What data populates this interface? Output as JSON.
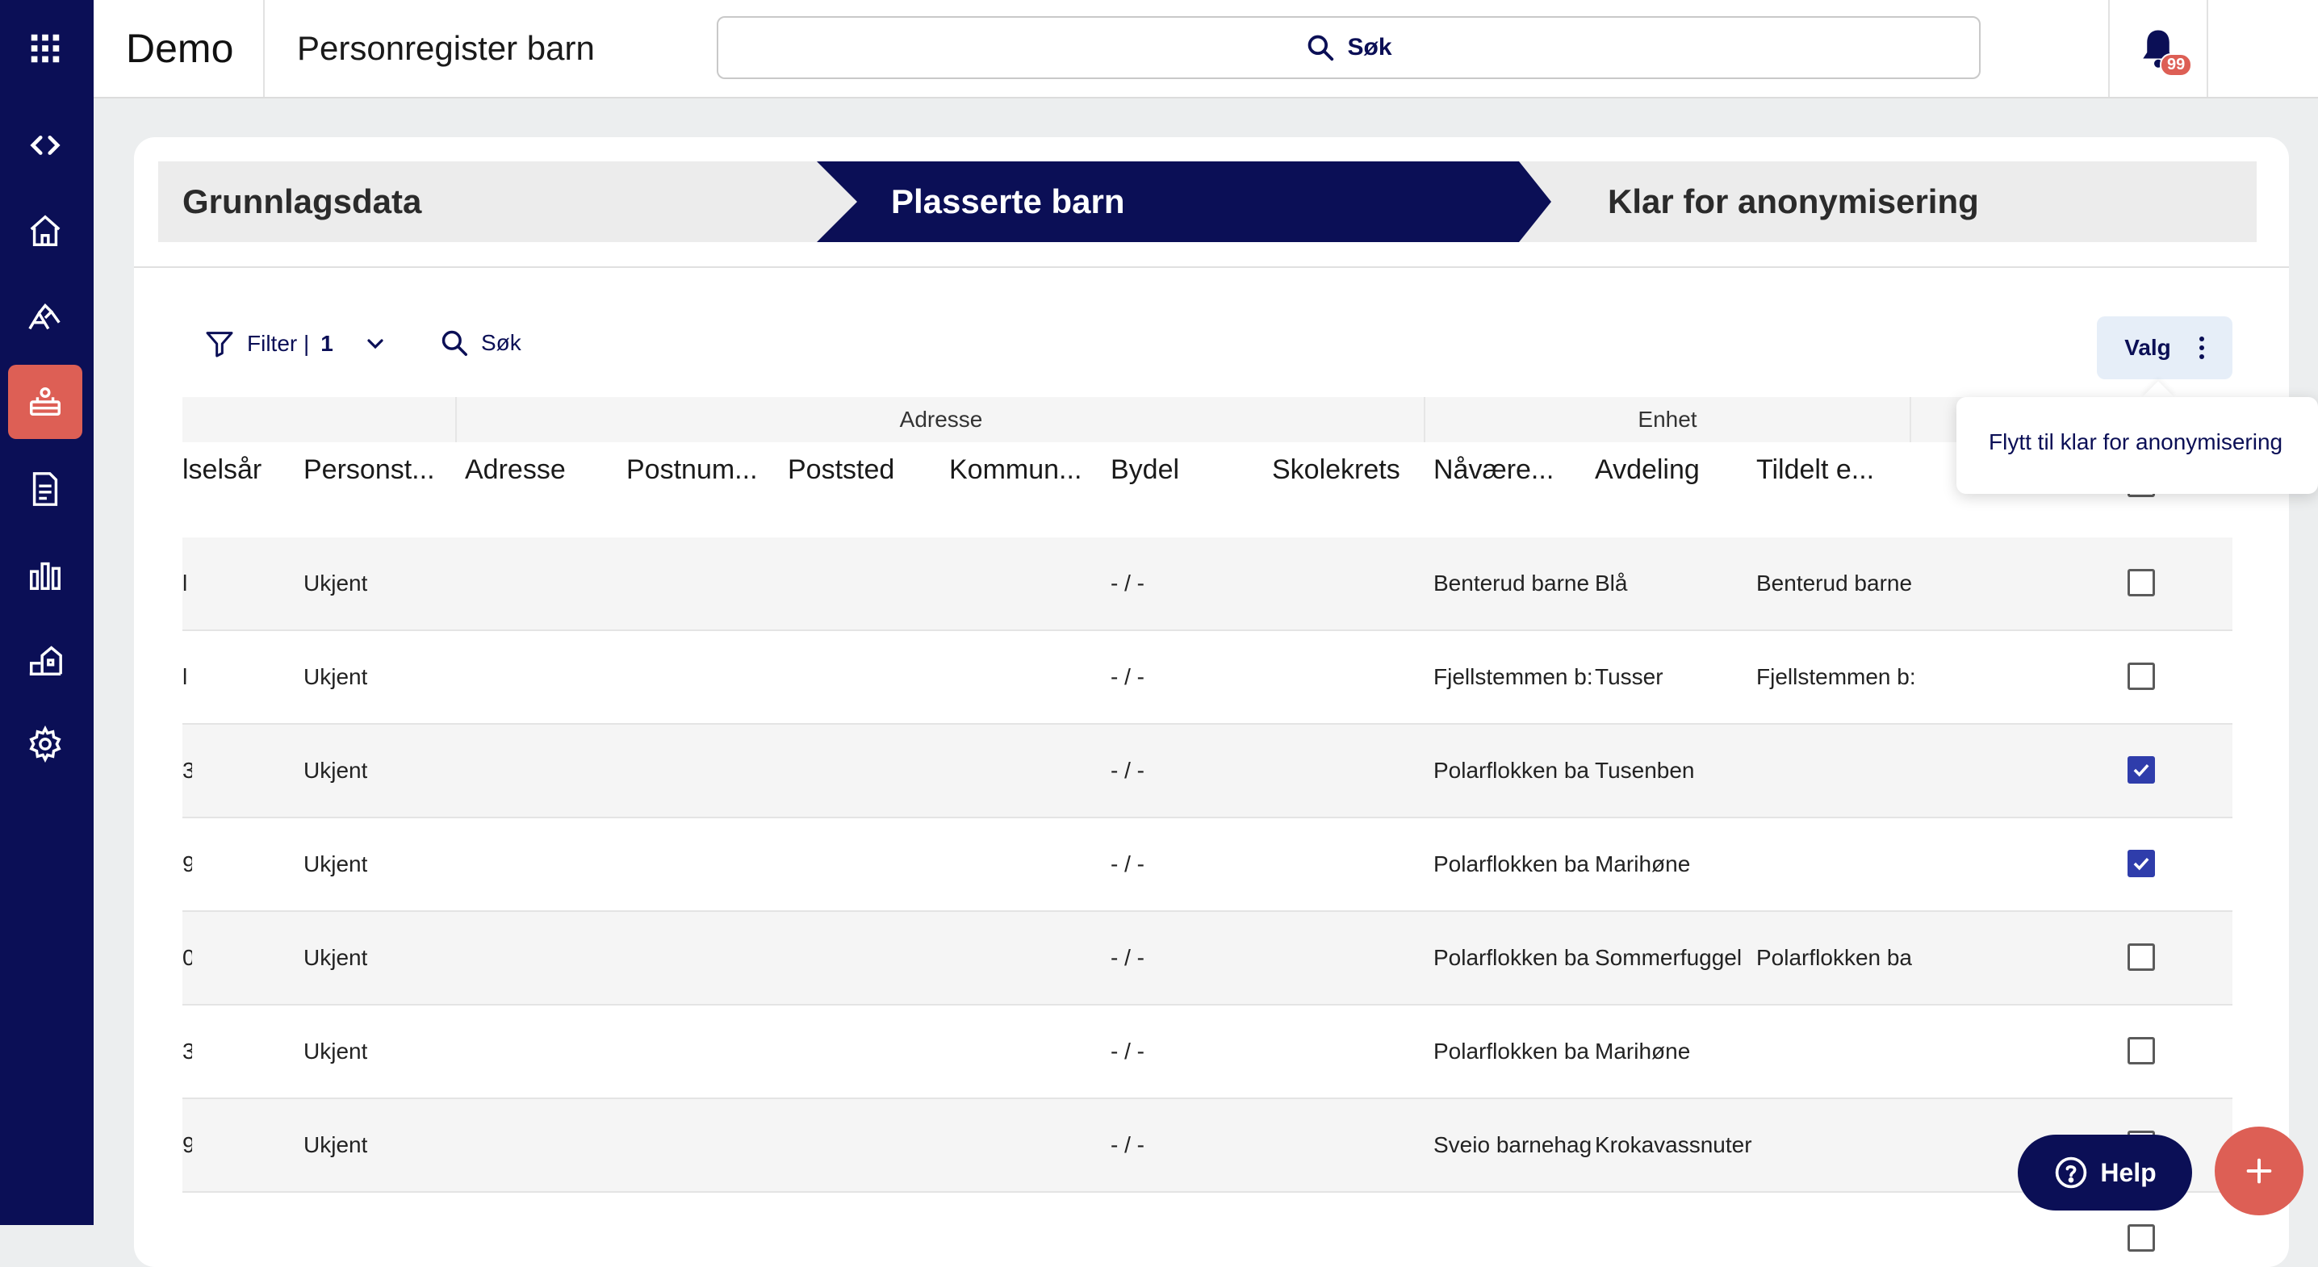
{
  "app": {
    "name": "Demo",
    "page_title": "Personregister barn"
  },
  "search": {
    "label": "Søk"
  },
  "notifications": {
    "count": "99"
  },
  "colors": {
    "navy": "#0b0f56",
    "coral": "#dd5f55",
    "checkbox_checked": "#2f3dab"
  },
  "sidebar": {
    "items": [
      {
        "icon": "apps-grid-icon"
      },
      {
        "icon": "expand-collapse-icon"
      },
      {
        "icon": "home-icon"
      },
      {
        "icon": "playground-icon"
      },
      {
        "icon": "child-register-icon",
        "active": true
      },
      {
        "icon": "document-icon"
      },
      {
        "icon": "bar-chart-icon"
      },
      {
        "icon": "buildings-icon"
      },
      {
        "icon": "settings-icon"
      }
    ]
  },
  "steps": {
    "items": [
      {
        "label": "Grunnlagsdata",
        "active": false
      },
      {
        "label": "Plasserte barn",
        "active": true
      },
      {
        "label": "Klar for anonymisering",
        "active": false
      }
    ]
  },
  "toolbar": {
    "filter_label": "Filter |",
    "filter_count": "1",
    "search_label": "Søk",
    "valg_label": "Valg"
  },
  "menu": {
    "item_move": "Flytt til klar for anonymisering"
  },
  "table": {
    "groups": {
      "adresse": "Adresse",
      "enhet": "Enhet"
    },
    "columns": {
      "fodselsar": "lselsår",
      "personstatus": "Personst...",
      "adresse": "Adresse",
      "postnummer": "Postnum...",
      "poststed": "Poststed",
      "kommune": "Kommun...",
      "bydel": "Bydel",
      "skolekrets": "Skolekrets",
      "navaerende": "Nåvære...",
      "avdeling": "Avdeling",
      "tildelt": "Tildelt e..."
    },
    "rows": [
      {
        "year": "l",
        "status": "Ukjent",
        "bydel": "- / -",
        "current": "Benterud barne",
        "dept": "Blå",
        "assigned": "Benterud barne",
        "checked": false
      },
      {
        "year": "l",
        "status": "Ukjent",
        "bydel": "- / -",
        "current": "Fjellstemmen b:",
        "dept": "Tusser",
        "assigned": "Fjellstemmen b:",
        "checked": false
      },
      {
        "year": "3",
        "status": "Ukjent",
        "bydel": "- / -",
        "current": "Polarflokken ba",
        "dept": "Tusenben",
        "assigned": "",
        "checked": true
      },
      {
        "year": "9",
        "status": "Ukjent",
        "bydel": "- / -",
        "current": "Polarflokken ba",
        "dept": "Marihøne",
        "assigned": "",
        "checked": true
      },
      {
        "year": "0",
        "status": "Ukjent",
        "bydel": "- / -",
        "current": "Polarflokken ba",
        "dept": "Sommerfuggel",
        "assigned": "Polarflokken ba",
        "checked": false
      },
      {
        "year": "3",
        "status": "Ukjent",
        "bydel": "- / -",
        "current": "Polarflokken ba",
        "dept": "Marihøne",
        "assigned": "",
        "checked": false
      },
      {
        "year": "9",
        "status": "Ukjent",
        "bydel": "- / -",
        "current": "Sveio barnehag",
        "dept": "Krokavassnuter",
        "assigned": "",
        "checked": false
      }
    ]
  },
  "help": {
    "label": "Help"
  }
}
